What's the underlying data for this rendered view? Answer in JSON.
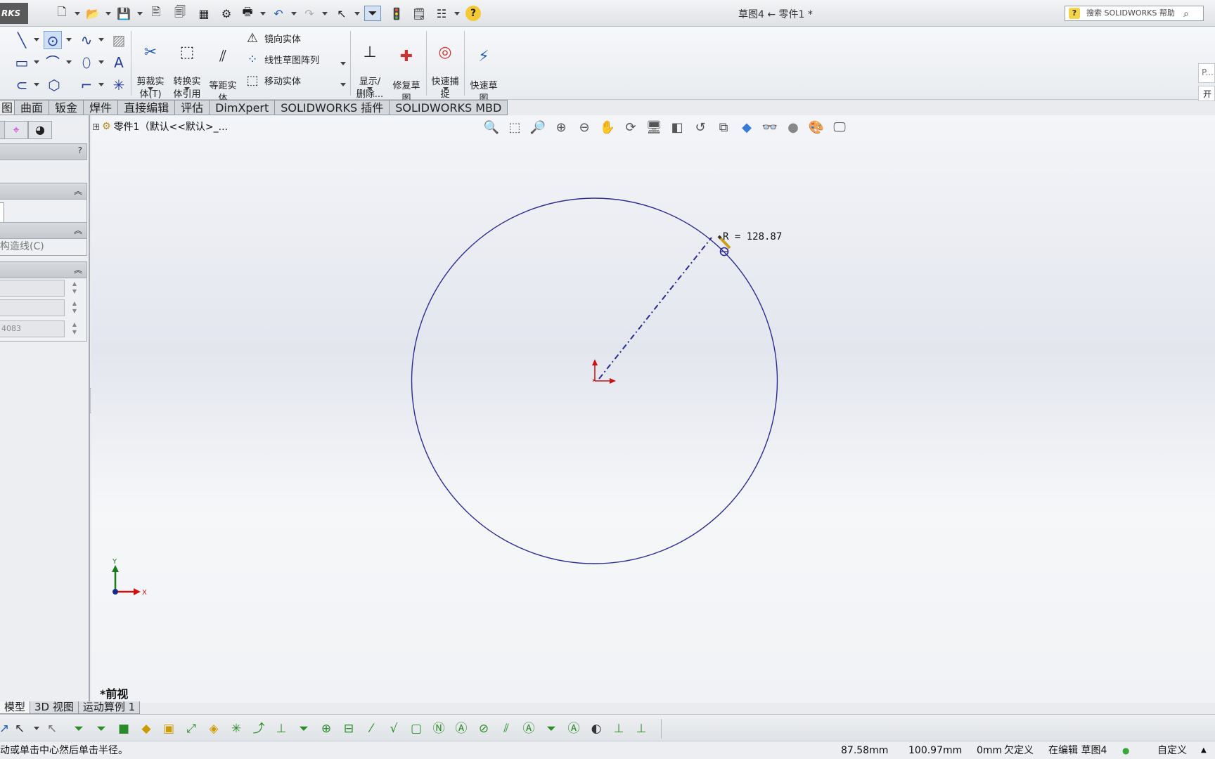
{
  "app": {
    "logo_text": "RKS",
    "document_title": "草图4 ← 零件1 *"
  },
  "search": {
    "placeholder": "搜索 SOLIDWORKS 帮助"
  },
  "ribbon": {
    "trim": "剪裁实\n体(T)",
    "convert": "转换实\n体引用",
    "offset": "等距实\n体",
    "mirror": "镜向实体",
    "linear_pattern": "线性草图阵列",
    "move": "移动实体",
    "show_delete": "显示/\n删除...",
    "repair": "修复草\n图",
    "quick_snap": "快速捕\n捉",
    "rapid_sketch": "快速草\n图",
    "right_stub_1": "P...",
    "right_stub_2": "开"
  },
  "tabs": [
    {
      "label": "图"
    },
    {
      "label": "曲面"
    },
    {
      "label": "钣金"
    },
    {
      "label": "焊件"
    },
    {
      "label": "直接编辑"
    },
    {
      "label": "评估"
    },
    {
      "label": "DimXpert"
    },
    {
      "label": "SOLIDWORKS 插件"
    },
    {
      "label": "SOLIDWORKS MBD"
    }
  ],
  "left_panel": {
    "help": "?",
    "construction": "构造线(C)",
    "param_value": "4083"
  },
  "tree": {
    "root": "零件1（默认<<默认>_..."
  },
  "sketch": {
    "dimension": "R = 128.87"
  },
  "view": {
    "name": "*前视",
    "axis_y": "Y",
    "axis_x": "X"
  },
  "bottom_tabs": [
    {
      "label": "模型"
    },
    {
      "label": "3D 视图"
    },
    {
      "label": "运动算例 1"
    }
  ],
  "status": {
    "message": "动或单击中心然后单击半径。",
    "x": "87.58mm",
    "y": "100.97mm",
    "z": "0mm",
    "state": "欠定义",
    "editing": "在编辑 草图4",
    "custom": "自定义"
  },
  "colors": {
    "sketch_blue": "#2b2b8f",
    "origin_red": "#cc1111",
    "axis_green": "#1a7a1a"
  }
}
